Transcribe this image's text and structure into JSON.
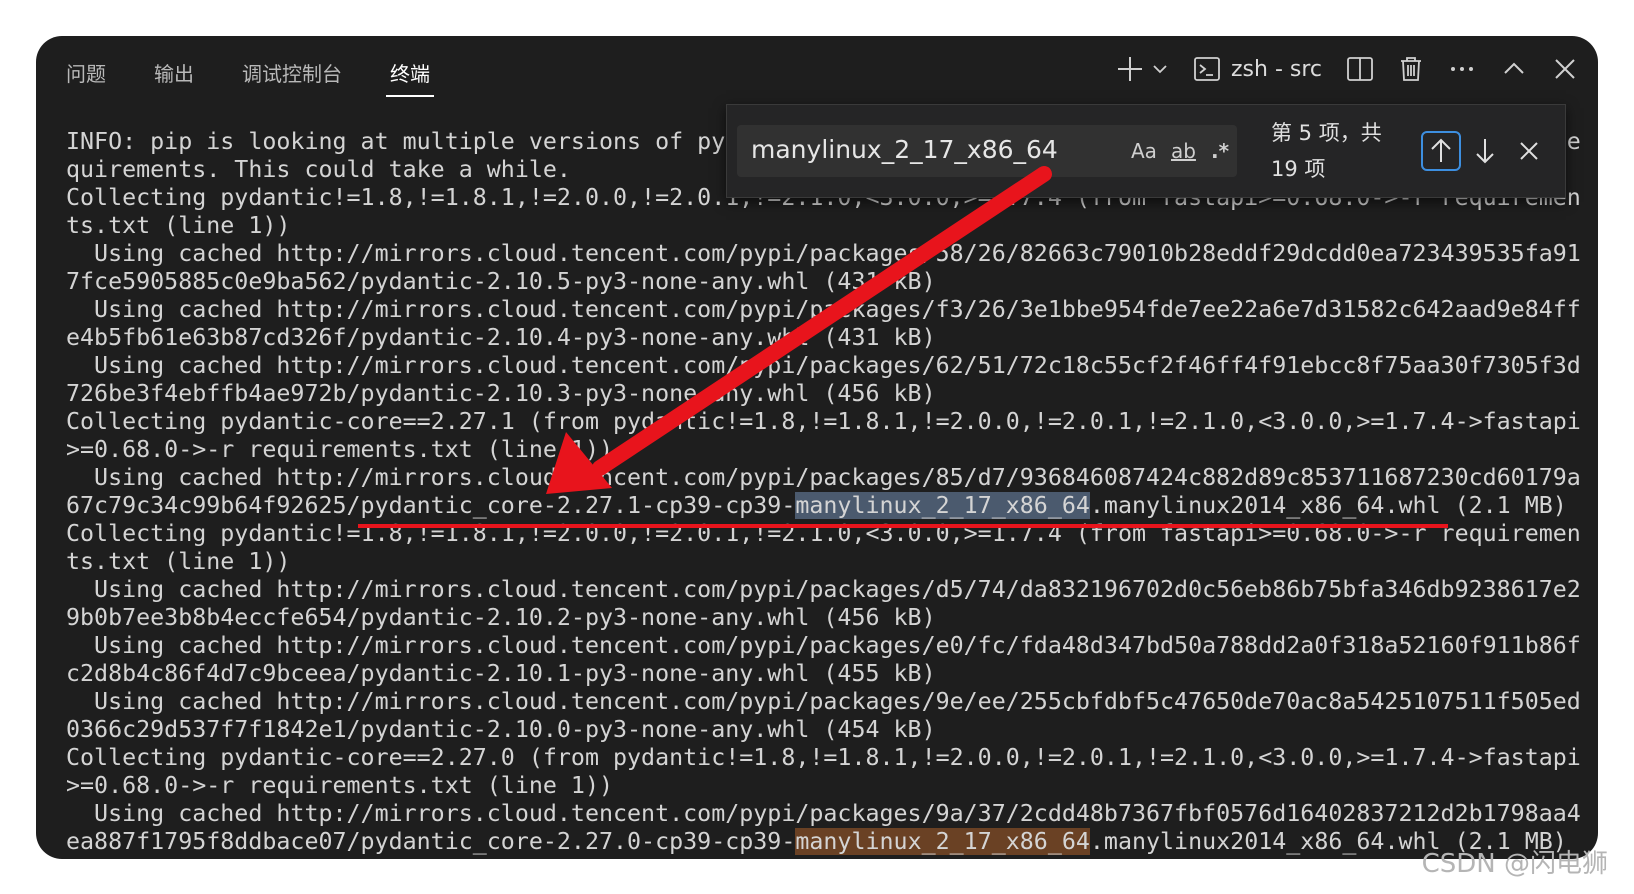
{
  "tabs": [
    {
      "label": "问题"
    },
    {
      "label": "输出"
    },
    {
      "label": "调试控制台"
    },
    {
      "label": "终端",
      "active": true
    }
  ],
  "toolbar": {
    "terminal_name": "zsh - src"
  },
  "find": {
    "query": "manylinux_2_17_x86_64",
    "match_case_label": "Aa",
    "whole_word_label": "ab",
    "regex_label": ".*",
    "count_line1": "第 5 项，共",
    "count_line2": "19 项"
  },
  "terminal": {
    "lines": [
      "INFO: pip is looking at multiple versions of pydantic to determine which version is compatible with other re",
      "quirements. This could take a while.",
      "Collecting pydantic!=1.8,!=1.8.1,!=2.0.0,!=2.0.1,!=2.1.0,<3.0.0,>=1.7.4 (from fastapi>=0.68.0->-r requiremen",
      "ts.txt (line 1))",
      "  Using cached http://mirrors.cloud.tencent.com/pypi/packages/58/26/82663c79010b28eddf29dcdd0ea723439535fa91",
      "7fce5905885c0e9ba562/pydantic-2.10.5-py3-none-any.whl (431 kB)",
      "  Using cached http://mirrors.cloud.tencent.com/pypi/packages/f3/26/3e1bbe954fde7ee22a6e7d31582c642aad9e84ff",
      "e4b5fb61e63b87cd326f/pydantic-2.10.4-py3-none-any.whl (431 kB)",
      "  Using cached http://mirrors.cloud.tencent.com/pypi/packages/62/51/72c18c55cf2f46ff4f91ebcc8f75aa30f7305f3d",
      "726be3f4ebffb4ae972b/pydantic-2.10.3-py3-none-any.whl (456 kB)",
      "Collecting pydantic-core==2.27.1 (from pydantic!=1.8,!=1.8.1,!=2.0.0,!=2.0.1,!=2.1.0,<3.0.0,>=1.7.4->fastapi",
      ">=0.68.0->-r requirements.txt (line 1))",
      "  Using cached http://mirrors.cloud.tencent.com/pypi/packages/85/d7/936846087424c882d89c853711687230cd60179a",
      "67c79c34c99b64f92625/pydantic_core-2.27.1-cp39-cp39-manylinux_2_17_x86_64.manylinux2014_x86_64.whl (2.1 MB)",
      "Collecting pydantic!=1.8,!=1.8.1,!=2.0.0,!=2.0.1,!=2.1.0,<3.0.0,>=1.7.4 (from fastapi>=0.68.0->-r requiremen",
      "ts.txt (line 1))",
      "  Using cached http://mirrors.cloud.tencent.com/pypi/packages/d5/74/da832196702d0c56eb86b75bfa346db9238617e2",
      "9b0b7ee3b8b4eccfe654/pydantic-2.10.2-py3-none-any.whl (456 kB)",
      "  Using cached http://mirrors.cloud.tencent.com/pypi/packages/e0/fc/fda48d347bd50a788dd2a0f318a52160f911b86f",
      "c2d8b4c86f4d7c9bceea/pydantic-2.10.1-py3-none-any.whl (455 kB)",
      "  Using cached http://mirrors.cloud.tencent.com/pypi/packages/9e/ee/255cbfdbf5c47650de70ac8a5425107511f505ed",
      "0366c29d537f7f1842e1/pydantic-2.10.0-py3-none-any.whl (454 kB)",
      "Collecting pydantic-core==2.27.0 (from pydantic!=1.8,!=1.8.1,!=2.0.0,!=2.0.1,!=2.1.0,<3.0.0,>=1.7.4->fastapi",
      ">=0.68.0->-r requirements.txt (line 1))",
      "  Using cached http://mirrors.cloud.tencent.com/pypi/packages/9a/37/2cdd48b7367fbf0576d16402837212d2b1798aa4",
      "ea887f1795f8ddbace07/pydantic_core-2.27.0-cp39-cp39-manylinux_2_17_x86_64.manylinux2014_x86_64.whl (2.1 MB)"
    ],
    "highlights": [
      {
        "line": 13,
        "text": "manylinux_2_17_x86_64",
        "kind": "active"
      },
      {
        "line": 25,
        "text": "manylinux_2_17_x86_64",
        "kind": "other"
      }
    ]
  },
  "annotation_color": "#e8141c",
  "watermark": "CSDN @闪电狮"
}
